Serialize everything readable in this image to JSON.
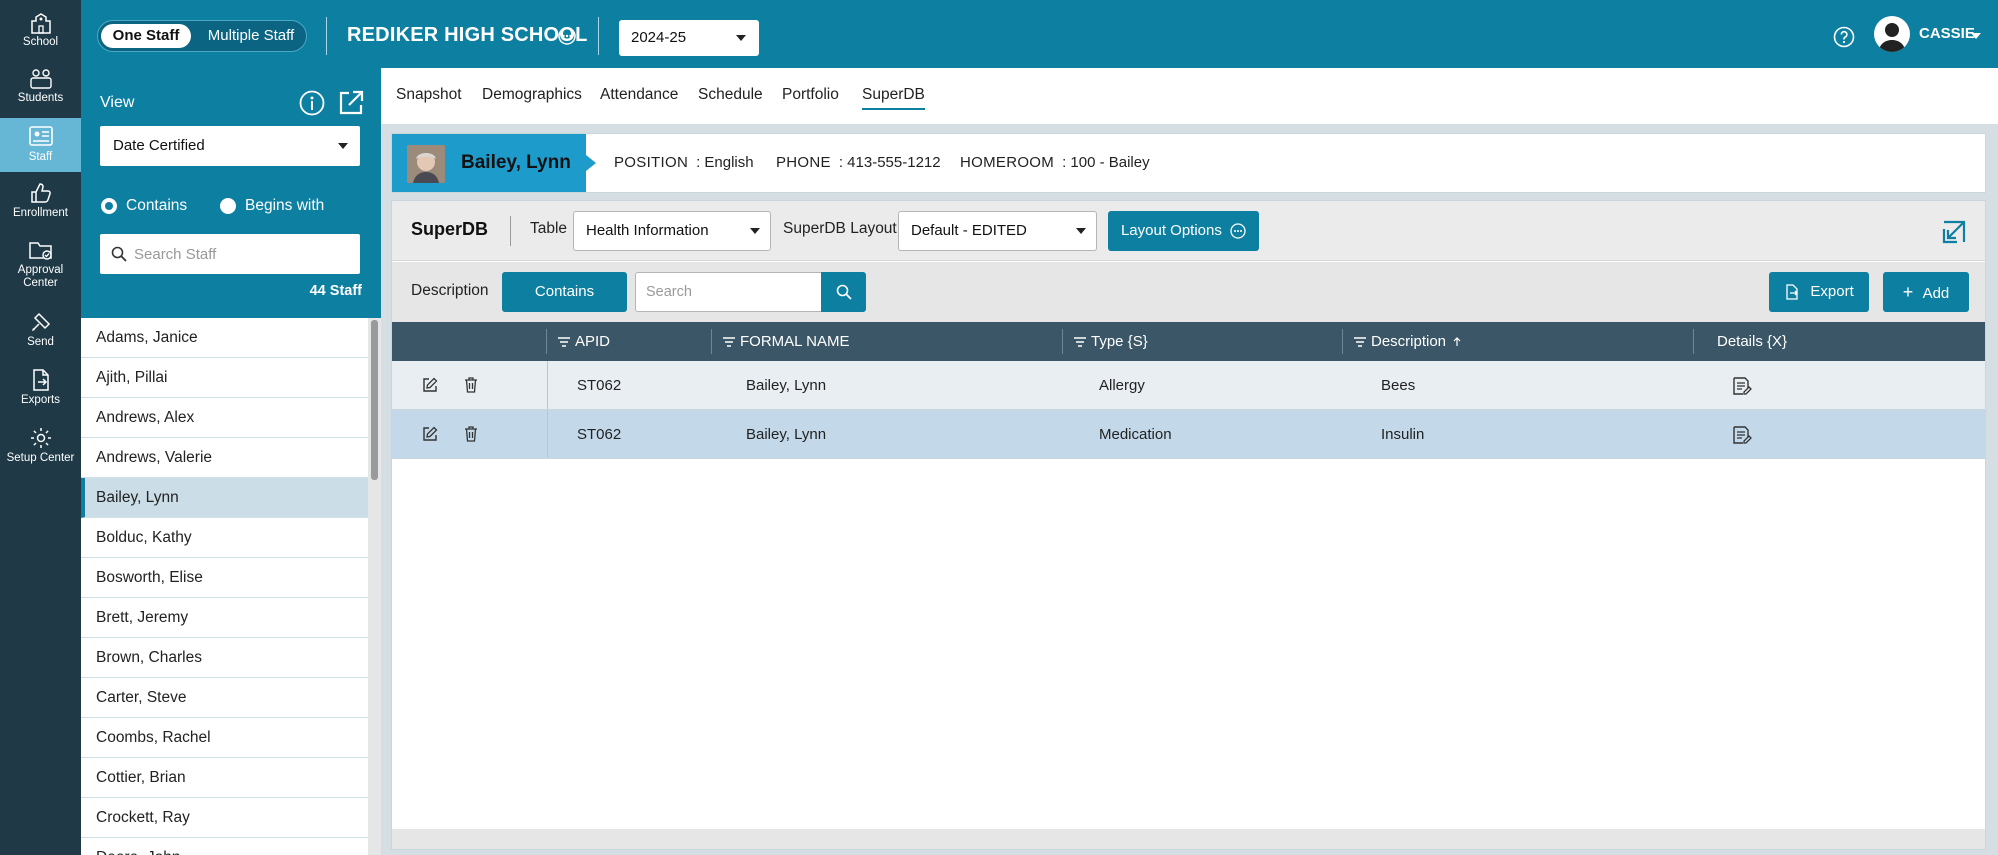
{
  "rail": {
    "items": [
      {
        "label": "School",
        "icon": "school-icon"
      },
      {
        "label": "Students",
        "icon": "students-icon"
      },
      {
        "label": "Staff",
        "icon": "staff-icon",
        "active": true
      },
      {
        "label": "Enrollment",
        "icon": "thumbs-up-icon"
      },
      {
        "label": "Approval Center",
        "icon": "folder-check-icon"
      },
      {
        "label": "Send",
        "icon": "satellite-icon"
      },
      {
        "label": "Exports",
        "icon": "export-icon"
      },
      {
        "label": "Setup Center",
        "icon": "gear-icon"
      }
    ]
  },
  "topbar": {
    "mode_one": "One Staff",
    "mode_multiple": "Multiple Staff",
    "school_name": "REDIKER HIGH SCHOOL",
    "year": "2024-25",
    "user": "CASSIE"
  },
  "left_panel": {
    "view_label": "View",
    "view_select": "Date Certified",
    "radio_contains": "Contains",
    "radio_begins": "Begins with",
    "search_placeholder": "Search Staff",
    "count": "44 Staff",
    "staff": [
      "Adams, Janice",
      "Ajith, Pillai",
      "Andrews, Alex",
      "Andrews, Valerie",
      "Bailey, Lynn",
      "Bolduc, Kathy",
      "Bosworth, Elise",
      "Brett, Jeremy",
      "Brown, Charles",
      "Carter, Steve",
      "Coombs, Rachel",
      "Cottier, Brian",
      "Crockett, Ray",
      "Deere, John"
    ],
    "selected_staff": "Bailey, Lynn"
  },
  "tabs": [
    "Snapshot",
    "Demographics",
    "Attendance",
    "Schedule",
    "Portfolio",
    "SuperDB"
  ],
  "active_tab": "SuperDB",
  "profile": {
    "name": "Bailey, Lynn",
    "position_label": "POSITION",
    "position_value": ": English",
    "phone_label": "PHONE",
    "phone_value": ": 413-555-1212",
    "homeroom_label": "HOMEROOM",
    "homeroom_value": ": 100 - Bailey"
  },
  "superdb": {
    "title": "SuperDB",
    "table_label": "Table",
    "table_value": "Health Information",
    "layout_label": "SuperDB Layout",
    "layout_value": "Default - EDITED",
    "layout_options": "Layout Options",
    "description_label": "Description",
    "contains_btn": "Contains",
    "search_placeholder": "Search",
    "export_btn": "Export",
    "add_btn": "Add"
  },
  "table": {
    "columns": [
      "APID",
      "FORMAL NAME",
      "Type {S}",
      "Description",
      "Details {X}"
    ],
    "rows": [
      {
        "apid": "ST062",
        "name": "Bailey, Lynn",
        "type": "Allergy",
        "description": "Bees"
      },
      {
        "apid": "ST062",
        "name": "Bailey, Lynn",
        "type": "Medication",
        "description": "Insulin"
      }
    ]
  },
  "colors": {
    "primary": "#0d7fa0",
    "rail": "#1f3a46",
    "table_header": "#3b5666",
    "selected_row": "#c3d9ea"
  }
}
